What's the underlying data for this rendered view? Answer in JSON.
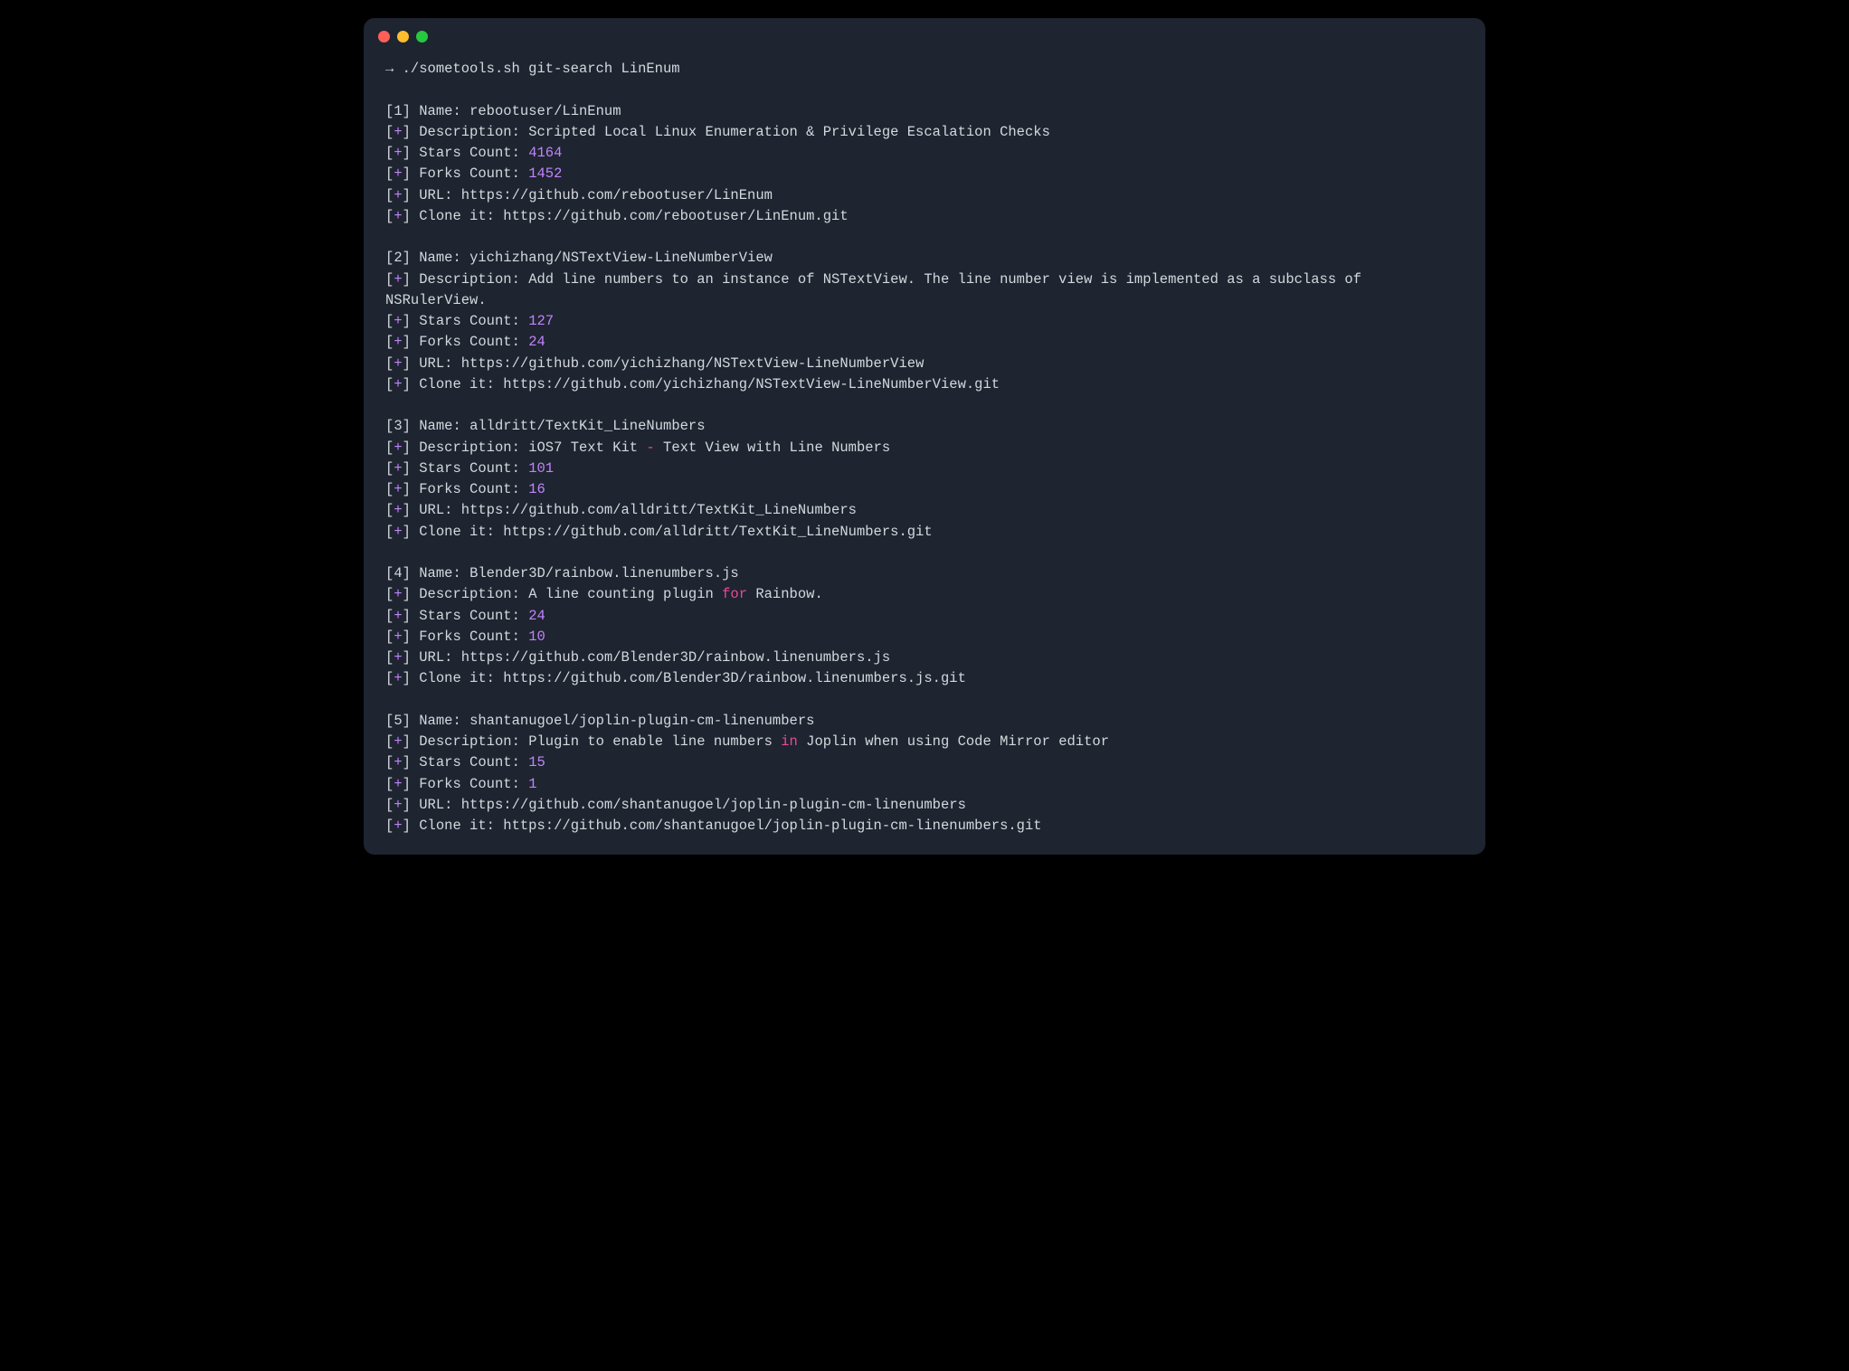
{
  "prompt": {
    "arrow": "→",
    "command": "./sometools.sh git-search LinEnum"
  },
  "labels": {
    "name": "Name:",
    "description": "Description:",
    "stars": "Stars Count:",
    "forks": "Forks Count:",
    "url": "URL:",
    "clone": "Clone it:"
  },
  "keywords": {
    "dash": "-",
    "for": "for",
    "in": "in"
  },
  "results": [
    {
      "idx": "1",
      "name": "rebootuser/LinEnum",
      "description_plain": "Scripted Local Linux Enumeration & Privilege Escalation Checks",
      "stars": "4164",
      "forks": "1452",
      "url": "https://github.com/rebootuser/LinEnum",
      "clone": "https://github.com/rebootuser/LinEnum.git"
    },
    {
      "idx": "2",
      "name": "yichizhang/NSTextView-LineNumberView",
      "description_plain": "Add line numbers to an instance of NSTextView. The line number view is implemented as a subclass of NSRulerView.",
      "stars": "127",
      "forks": "24",
      "url": "https://github.com/yichizhang/NSTextView-LineNumberView",
      "clone": "https://github.com/yichizhang/NSTextView-LineNumberView.git"
    },
    {
      "idx": "3",
      "name": "alldritt/TextKit_LineNumbers",
      "description_pre": "iOS7 Text Kit ",
      "description_kw": "-",
      "description_post": " Text View with Line Numbers",
      "stars": "101",
      "forks": "16",
      "url": "https://github.com/alldritt/TextKit_LineNumbers",
      "clone": "https://github.com/alldritt/TextKit_LineNumbers.git"
    },
    {
      "idx": "4",
      "name": "Blender3D/rainbow.linenumbers.js",
      "description_pre": "A line counting plugin ",
      "description_kw": "for",
      "description_post": " Rainbow.",
      "stars": "24",
      "forks": "10",
      "url": "https://github.com/Blender3D/rainbow.linenumbers.js",
      "clone": "https://github.com/Blender3D/rainbow.linenumbers.js.git"
    },
    {
      "idx": "5",
      "name": "shantanugoel/joplin-plugin-cm-linenumbers",
      "description_pre": "Plugin to enable line numbers ",
      "description_kw": "in",
      "description_post": " Joplin when using Code Mirror editor",
      "stars": "15",
      "forks": "1",
      "url": "https://github.com/shantanugoel/joplin-plugin-cm-linenumbers",
      "clone": "https://github.com/shantanugoel/joplin-plugin-cm-linenumbers.git"
    }
  ]
}
